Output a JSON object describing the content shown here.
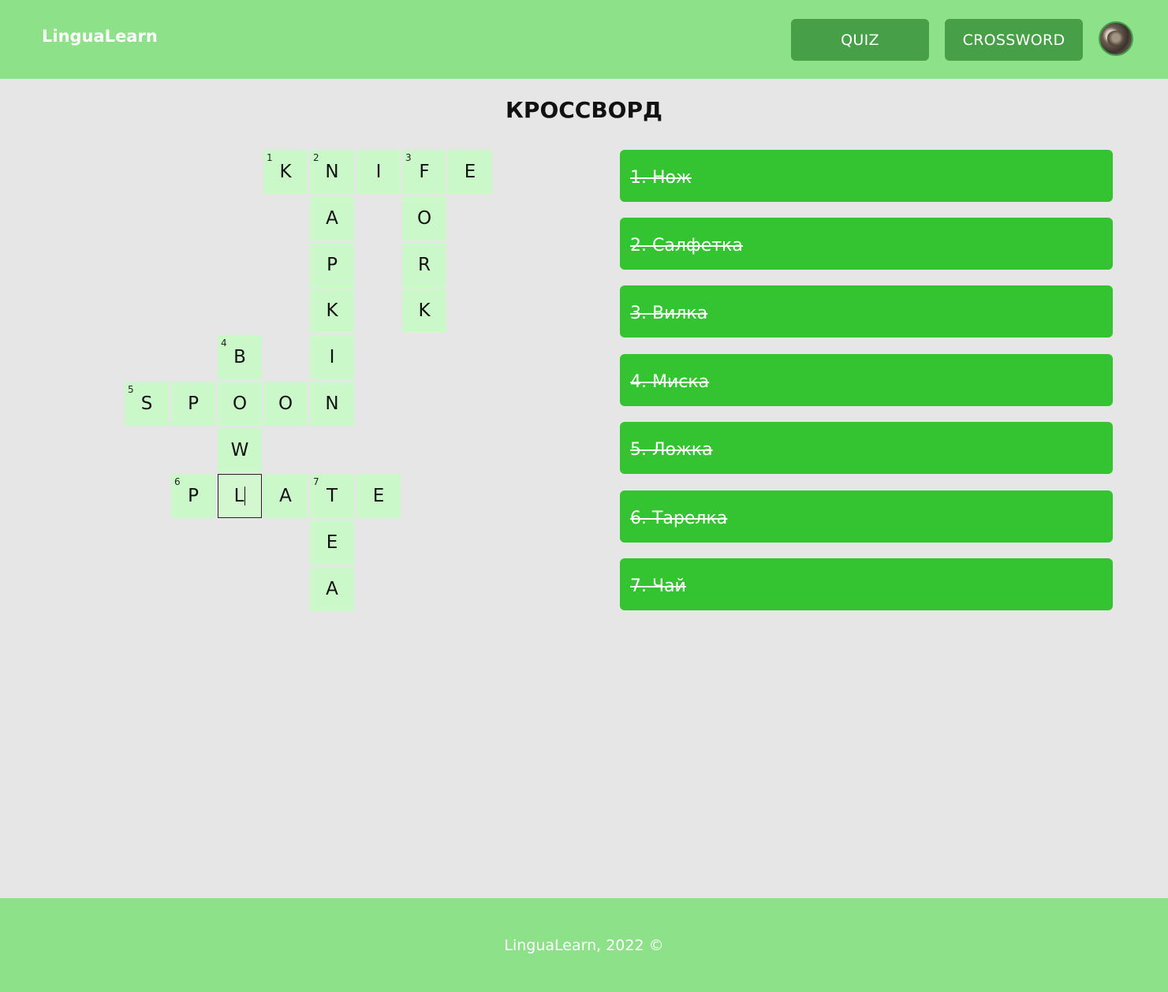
{
  "app": {
    "title": "LinguaLearn"
  },
  "nav": {
    "quiz_label": "QUIZ",
    "crossword_label": "CROSSWORD"
  },
  "page": {
    "title": "КРОССВОРД"
  },
  "crossword": {
    "cells": [
      {
        "letter": "K",
        "number": "1"
      },
      {
        "letter": "N",
        "number": "2"
      },
      {
        "letter": "I",
        "number": ""
      },
      {
        "letter": "F",
        "number": "3"
      },
      {
        "letter": "E",
        "number": ""
      },
      {
        "letter": "A",
        "number": ""
      },
      {
        "letter": "O",
        "number": ""
      },
      {
        "letter": "P",
        "number": ""
      },
      {
        "letter": "R",
        "number": ""
      },
      {
        "letter": "K",
        "number": ""
      },
      {
        "letter": "K",
        "number": ""
      },
      {
        "letter": "B",
        "number": "4"
      },
      {
        "letter": "I",
        "number": ""
      },
      {
        "letter": "S",
        "number": "5"
      },
      {
        "letter": "P",
        "number": ""
      },
      {
        "letter": "O",
        "number": ""
      },
      {
        "letter": "O",
        "number": ""
      },
      {
        "letter": "N",
        "number": ""
      },
      {
        "letter": "W",
        "number": ""
      },
      {
        "letter": "P",
        "number": "6"
      },
      {
        "letter": "L",
        "number": ""
      },
      {
        "letter": "A",
        "number": ""
      },
      {
        "letter": "T",
        "number": "7"
      },
      {
        "letter": "E",
        "number": ""
      },
      {
        "letter": "E",
        "number": ""
      },
      {
        "letter": "A",
        "number": ""
      }
    ]
  },
  "clues": [
    {
      "text": "1. Нож"
    },
    {
      "text": "2. Салфетка"
    },
    {
      "text": "3. Вилка"
    },
    {
      "text": "4. Миска"
    },
    {
      "text": "5. Ложка"
    },
    {
      "text": "6. Тарелка"
    },
    {
      "text": "7. Чай"
    }
  ],
  "footer": {
    "text": "LinguaLearn, 2022 ©"
  },
  "colors": {
    "header_bg": "#8de188",
    "nav_button_bg": "#47a048",
    "cell_bg": "#cbf8c8",
    "clue_bg": "#34c432",
    "page_bg": "#e6e6e6"
  }
}
